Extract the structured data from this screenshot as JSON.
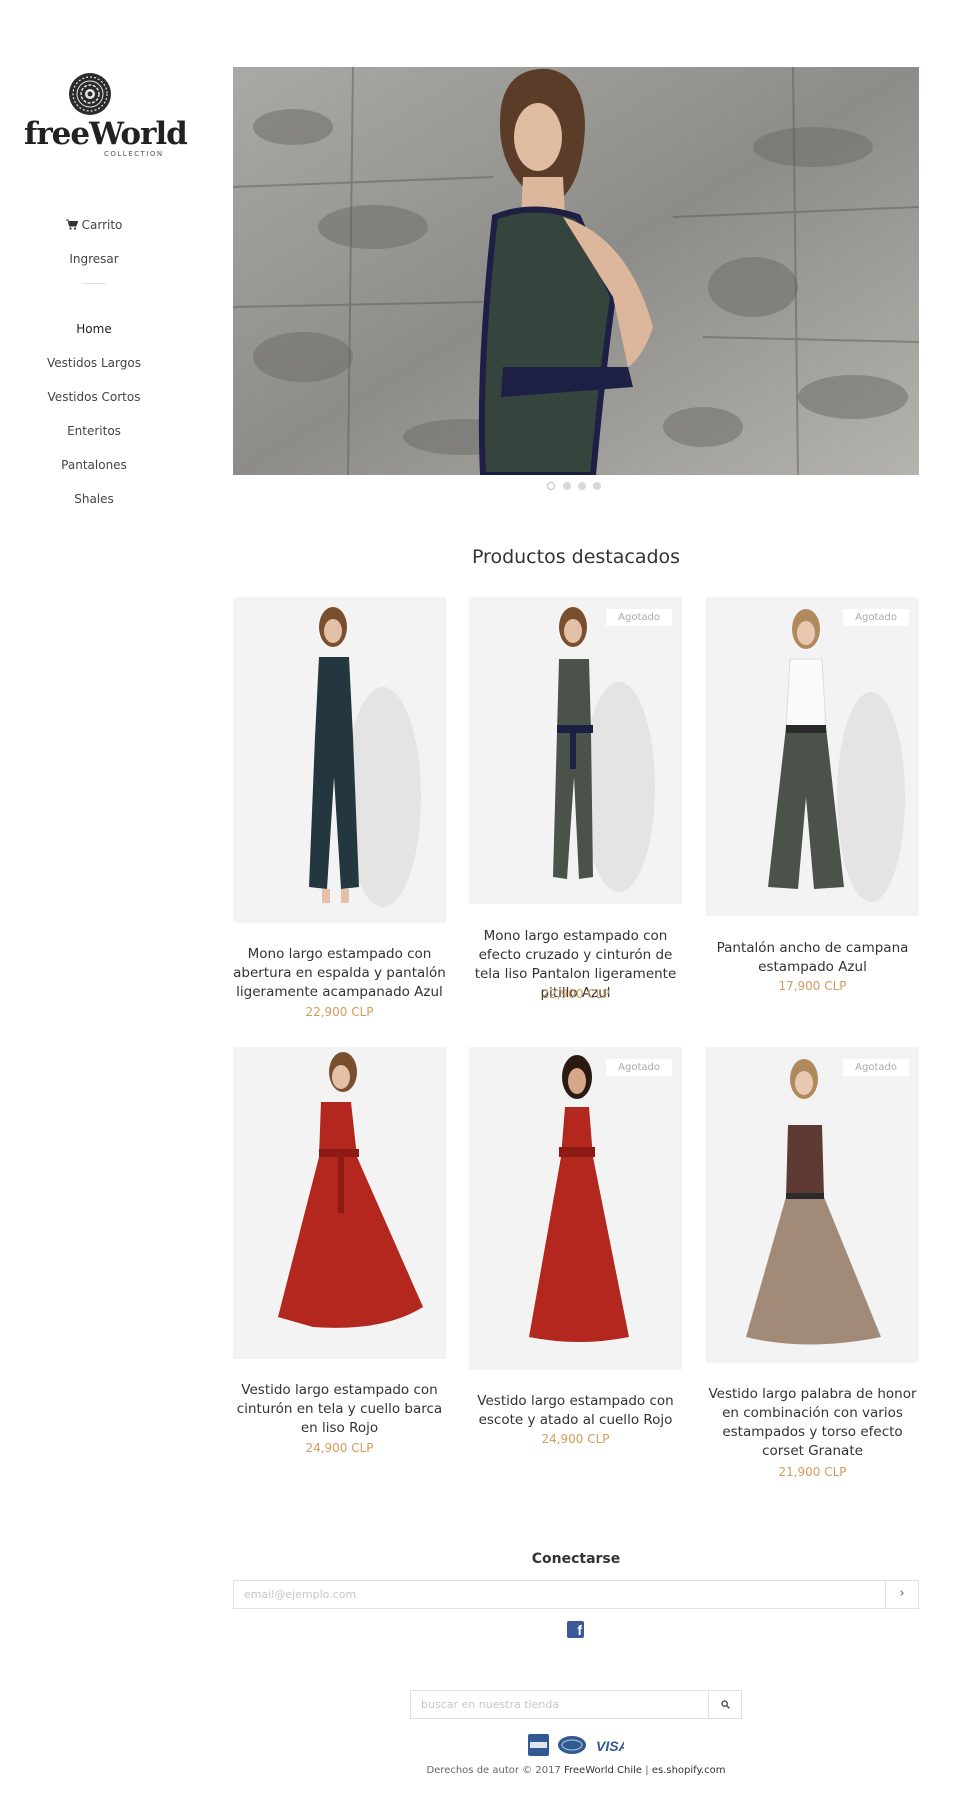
{
  "brand": {
    "name": "freeWorld",
    "subtitle": "COLLECTION"
  },
  "sidebar": {
    "cart_label": "Carrito",
    "login_label": "Ingresar",
    "menu": [
      {
        "label": "Home",
        "active": true
      },
      {
        "label": "Vestidos Largos",
        "active": false
      },
      {
        "label": "Vestidos Cortos",
        "active": false
      },
      {
        "label": "Enteritos",
        "active": false
      },
      {
        "label": "Pantalones",
        "active": false
      },
      {
        "label": "Shales",
        "active": false
      }
    ]
  },
  "slideshow": {
    "slide_count": 4,
    "active_index": 0
  },
  "featured": {
    "title": "Productos destacados",
    "products": [
      {
        "title": "Mono largo estampado con abertura en espalda y pantalón ligeramente acampanado Azul",
        "price": "22,900 CLP",
        "badge": ""
      },
      {
        "title": "Mono largo estampado con efecto cruzado y cinturón de tela liso Pantalon ligeramente pitillo Azul",
        "price": "22,900 CLP",
        "badge": "Agotado"
      },
      {
        "title": "Pantalón ancho de campana estampado Azul",
        "price": "17,900 CLP",
        "badge": "Agotado"
      },
      {
        "title": "Vestido largo estampado con cinturón en tela y cuello barca en liso Rojo",
        "price": "24,900 CLP",
        "badge": ""
      },
      {
        "title": "Vestido largo estampado con escote y atado al cuello Rojo",
        "price": "24,900 CLP",
        "badge": "Agotado"
      },
      {
        "title": "Vestido largo palabra de honor en combinación con varios estampados y torso efecto corset Granate",
        "price": "21,900 CLP",
        "badge": "Agotado"
      }
    ]
  },
  "newsletter": {
    "title": "Conectarse",
    "placeholder": "email@ejemplo.com",
    "submit_icon": "chevron-right-icon",
    "social": "facebook-icon"
  },
  "footer": {
    "search_placeholder": "buscar en nuestra tienda",
    "payment_icons": [
      "american-express-icon",
      "mastercard-icon",
      "visa-icon"
    ],
    "visa_text": "VISA",
    "copyright_prefix": "Derechos de autor © 2017",
    "store_link": "FreeWorld Chile",
    "separator": "|",
    "platform_link": "es.shopify.com"
  },
  "colors": {
    "price": "#d59a5f",
    "facebook": "#3b5998",
    "badge_text": "#aaaaaa"
  }
}
